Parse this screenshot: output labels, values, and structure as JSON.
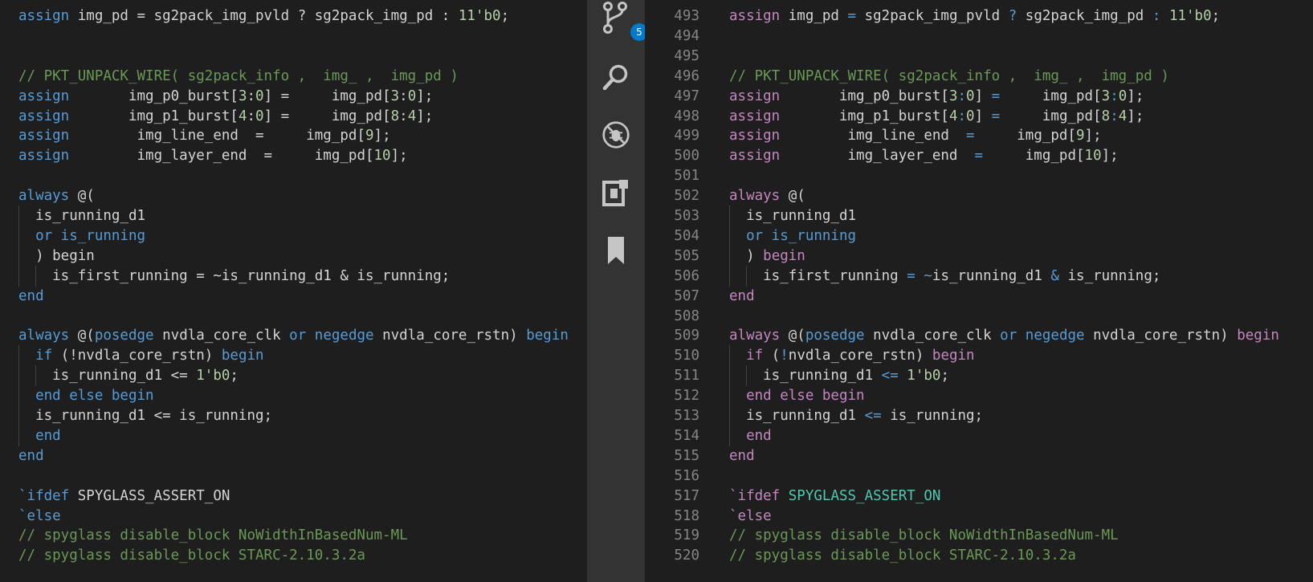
{
  "left_pane": {
    "lines": [
      {
        "tokens": [
          [
            "kw",
            "assign"
          ],
          [
            "op",
            " img_pd = sg2pack_img_pvld ? sg2pack_img_pd : "
          ],
          [
            "nm",
            "11'b0"
          ],
          [
            "op",
            ";"
          ]
        ]
      },
      {
        "tokens": []
      },
      {
        "tokens": []
      },
      {
        "tokens": [
          [
            "cm",
            "// PKT_UNPACK_WIRE( sg2pack_info ,  img_ ,  img_pd )"
          ]
        ]
      },
      {
        "tokens": [
          [
            "kw",
            "assign"
          ],
          [
            "op",
            "       img_p0_burst["
          ],
          [
            "nm",
            "3"
          ],
          [
            "op",
            ":"
          ],
          [
            "nm",
            "0"
          ],
          [
            "op",
            "] =     img_pd["
          ],
          [
            "nm",
            "3"
          ],
          [
            "op",
            ":"
          ],
          [
            "nm",
            "0"
          ],
          [
            "op",
            "];"
          ]
        ]
      },
      {
        "tokens": [
          [
            "kw",
            "assign"
          ],
          [
            "op",
            "       img_p1_burst["
          ],
          [
            "nm",
            "4"
          ],
          [
            "op",
            ":"
          ],
          [
            "nm",
            "0"
          ],
          [
            "op",
            "] =     img_pd["
          ],
          [
            "nm",
            "8"
          ],
          [
            "op",
            ":"
          ],
          [
            "nm",
            "4"
          ],
          [
            "op",
            "];"
          ]
        ]
      },
      {
        "tokens": [
          [
            "kw",
            "assign"
          ],
          [
            "op",
            "        img_line_end  =     img_pd["
          ],
          [
            "nm",
            "9"
          ],
          [
            "op",
            "];"
          ]
        ]
      },
      {
        "tokens": [
          [
            "kw",
            "assign"
          ],
          [
            "op",
            "        img_layer_end  =     img_pd["
          ],
          [
            "nm",
            "10"
          ],
          [
            "op",
            "];"
          ]
        ]
      },
      {
        "tokens": []
      },
      {
        "tokens": [
          [
            "kw",
            "always"
          ],
          [
            "op",
            " @("
          ]
        ]
      },
      {
        "tokens": [
          [
            "op",
            "  is_running_d1"
          ]
        ],
        "guides": [
          1
        ]
      },
      {
        "tokens": [
          [
            "op",
            "  "
          ],
          [
            "kw",
            "or is_running"
          ]
        ],
        "guides": [
          1
        ]
      },
      {
        "tokens": [
          [
            "op",
            "  ) begin"
          ]
        ],
        "guides": [
          1
        ]
      },
      {
        "tokens": [
          [
            "op",
            "    is_first_running = ~is_running_d1 & is_running;"
          ]
        ],
        "guides": [
          1,
          2
        ]
      },
      {
        "tokens": [
          [
            "kw",
            "end"
          ]
        ]
      },
      {
        "tokens": []
      },
      {
        "tokens": [
          [
            "kw",
            "always"
          ],
          [
            "op",
            " @("
          ],
          [
            "kw",
            "posedge"
          ],
          [
            "op",
            " nvdla_core_clk "
          ],
          [
            "kw",
            "or"
          ],
          [
            "op",
            " "
          ],
          [
            "kw",
            "negedge"
          ],
          [
            "op",
            " nvdla_core_rstn) "
          ],
          [
            "kw",
            "begin"
          ]
        ]
      },
      {
        "tokens": [
          [
            "op",
            "  "
          ],
          [
            "kw",
            "if"
          ],
          [
            "op",
            " (!nvdla_core_rstn) "
          ],
          [
            "kw",
            "begin"
          ]
        ],
        "guides": [
          1
        ]
      },
      {
        "tokens": [
          [
            "op",
            "    is_running_d1 <= "
          ],
          [
            "nm",
            "1'b0"
          ],
          [
            "op",
            ";"
          ]
        ],
        "guides": [
          1,
          2
        ]
      },
      {
        "tokens": [
          [
            "op",
            "  "
          ],
          [
            "kw",
            "end else begin"
          ]
        ],
        "guides": [
          1
        ]
      },
      {
        "tokens": [
          [
            "op",
            "  is_running_d1 <= is_running;"
          ]
        ],
        "guides": [
          1
        ]
      },
      {
        "tokens": [
          [
            "op",
            "  "
          ],
          [
            "kw",
            "end"
          ]
        ],
        "guides": [
          1
        ]
      },
      {
        "tokens": [
          [
            "kw",
            "end"
          ]
        ]
      },
      {
        "tokens": []
      },
      {
        "tokens": [
          [
            "kw",
            "`ifdef"
          ],
          [
            "op",
            " SPYGLASS_ASSERT_ON"
          ]
        ]
      },
      {
        "tokens": [
          [
            "kw",
            "`else"
          ]
        ]
      },
      {
        "tokens": [
          [
            "cm",
            "// spyglass disable_block NoWidthInBasedNum-ML"
          ]
        ]
      },
      {
        "tokens": [
          [
            "cm",
            "// spyglass disable_block STARC-2.10.3.2a"
          ]
        ]
      }
    ]
  },
  "activity_bar": {
    "source_control_badge": "5",
    "icons": [
      "source-control-icon",
      "search-icon",
      "debug-icon",
      "extensions-icon",
      "bookmark-icon"
    ]
  },
  "right_pane": {
    "lines": [
      {
        "n": "493",
        "tokens": [
          [
            "kw2",
            "assign"
          ],
          [
            "op",
            " img_pd "
          ],
          [
            "op2",
            "="
          ],
          [
            "op",
            " sg2pack_img_pvld "
          ],
          [
            "op2",
            "?"
          ],
          [
            "op",
            " sg2pack_img_pd "
          ],
          [
            "op2",
            ":"
          ],
          [
            "op",
            " "
          ],
          [
            "nm",
            "11'b0"
          ],
          [
            "op",
            ";"
          ]
        ]
      },
      {
        "n": "494",
        "tokens": []
      },
      {
        "n": "495",
        "tokens": []
      },
      {
        "n": "496",
        "tokens": [
          [
            "cm",
            "// PKT_UNPACK_WIRE( sg2pack_info ,  img_ ,  img_pd )"
          ]
        ]
      },
      {
        "n": "497",
        "tokens": [
          [
            "kw2",
            "assign"
          ],
          [
            "op",
            "       img_p0_burst["
          ],
          [
            "nm",
            "3"
          ],
          [
            "op2",
            ":"
          ],
          [
            "nm",
            "0"
          ],
          [
            "op",
            "] "
          ],
          [
            "op2",
            "="
          ],
          [
            "op",
            "     img_pd["
          ],
          [
            "nm",
            "3"
          ],
          [
            "op2",
            ":"
          ],
          [
            "nm",
            "0"
          ],
          [
            "op",
            "];"
          ]
        ]
      },
      {
        "n": "498",
        "tokens": [
          [
            "kw2",
            "assign"
          ],
          [
            "op",
            "       img_p1_burst["
          ],
          [
            "nm",
            "4"
          ],
          [
            "op2",
            ":"
          ],
          [
            "nm",
            "0"
          ],
          [
            "op",
            "] "
          ],
          [
            "op2",
            "="
          ],
          [
            "op",
            "     img_pd["
          ],
          [
            "nm",
            "8"
          ],
          [
            "op2",
            ":"
          ],
          [
            "nm",
            "4"
          ],
          [
            "op",
            "];"
          ]
        ]
      },
      {
        "n": "499",
        "tokens": [
          [
            "kw2",
            "assign"
          ],
          [
            "op",
            "        img_line_end  "
          ],
          [
            "op2",
            "="
          ],
          [
            "op",
            "     img_pd["
          ],
          [
            "nm",
            "9"
          ],
          [
            "op",
            "];"
          ]
        ]
      },
      {
        "n": "500",
        "tokens": [
          [
            "kw2",
            "assign"
          ],
          [
            "op",
            "        img_layer_end  "
          ],
          [
            "op2",
            "="
          ],
          [
            "op",
            "     img_pd["
          ],
          [
            "nm",
            "10"
          ],
          [
            "op",
            "];"
          ]
        ]
      },
      {
        "n": "501",
        "tokens": []
      },
      {
        "n": "502",
        "tokens": [
          [
            "kw2",
            "always"
          ],
          [
            "op",
            " @("
          ]
        ]
      },
      {
        "n": "503",
        "tokens": [
          [
            "op",
            "  is_running_d1"
          ]
        ],
        "guides": [
          1
        ]
      },
      {
        "n": "504",
        "tokens": [
          [
            "op",
            "  "
          ],
          [
            "kw",
            "or is_running"
          ]
        ],
        "guides": [
          1
        ]
      },
      {
        "n": "505",
        "tokens": [
          [
            "op",
            "  ) "
          ],
          [
            "kw2",
            "begin"
          ]
        ],
        "guides": [
          1
        ]
      },
      {
        "n": "506",
        "tokens": [
          [
            "op",
            "    is_first_running "
          ],
          [
            "op2",
            "="
          ],
          [
            "op",
            " "
          ],
          [
            "op2",
            "~"
          ],
          [
            "op",
            "is_running_d1 "
          ],
          [
            "op2",
            "&"
          ],
          [
            "op",
            " is_running;"
          ]
        ],
        "guides": [
          1,
          2
        ]
      },
      {
        "n": "507",
        "tokens": [
          [
            "kw2",
            "end"
          ]
        ]
      },
      {
        "n": "508",
        "tokens": []
      },
      {
        "n": "509",
        "tokens": [
          [
            "kw2",
            "always"
          ],
          [
            "op",
            " @("
          ],
          [
            "kw",
            "posedge"
          ],
          [
            "op",
            " nvdla_core_clk "
          ],
          [
            "kw",
            "or"
          ],
          [
            "op",
            " "
          ],
          [
            "kw",
            "negedge"
          ],
          [
            "op",
            " nvdla_core_rstn) "
          ],
          [
            "kw2",
            "begin"
          ]
        ]
      },
      {
        "n": "510",
        "tokens": [
          [
            "op",
            "  "
          ],
          [
            "kw2",
            "if"
          ],
          [
            "op",
            " ("
          ],
          [
            "op2",
            "!"
          ],
          [
            "op",
            "nvdla_core_rstn) "
          ],
          [
            "kw2",
            "begin"
          ]
        ],
        "guides": [
          1
        ]
      },
      {
        "n": "511",
        "tokens": [
          [
            "op",
            "    is_running_d1 "
          ],
          [
            "op2",
            "<="
          ],
          [
            "op",
            " "
          ],
          [
            "nm",
            "1'b0"
          ],
          [
            "op",
            ";"
          ]
        ],
        "guides": [
          1,
          2
        ]
      },
      {
        "n": "512",
        "tokens": [
          [
            "op",
            "  "
          ],
          [
            "kw2",
            "end else begin"
          ]
        ],
        "guides": [
          1
        ]
      },
      {
        "n": "513",
        "tokens": [
          [
            "op",
            "  is_running_d1 "
          ],
          [
            "op2",
            "<="
          ],
          [
            "op",
            " is_running;"
          ]
        ],
        "guides": [
          1
        ]
      },
      {
        "n": "514",
        "tokens": [
          [
            "op",
            "  "
          ],
          [
            "kw2",
            "end"
          ]
        ],
        "guides": [
          1
        ]
      },
      {
        "n": "515",
        "tokens": [
          [
            "kw2",
            "end"
          ]
        ]
      },
      {
        "n": "516",
        "tokens": []
      },
      {
        "n": "517",
        "tokens": [
          [
            "kw2",
            "`ifdef"
          ],
          [
            "op",
            " "
          ],
          [
            "mac",
            "SPYGLASS_ASSERT_ON"
          ]
        ]
      },
      {
        "n": "518",
        "tokens": [
          [
            "kw2",
            "`else"
          ]
        ]
      },
      {
        "n": "519",
        "tokens": [
          [
            "cm",
            "// spyglass disable_block NoWidthInBasedNum-ML"
          ]
        ]
      },
      {
        "n": "520",
        "tokens": [
          [
            "cm",
            "// spyglass disable_block STARC-2.10.3.2a"
          ]
        ]
      }
    ]
  }
}
